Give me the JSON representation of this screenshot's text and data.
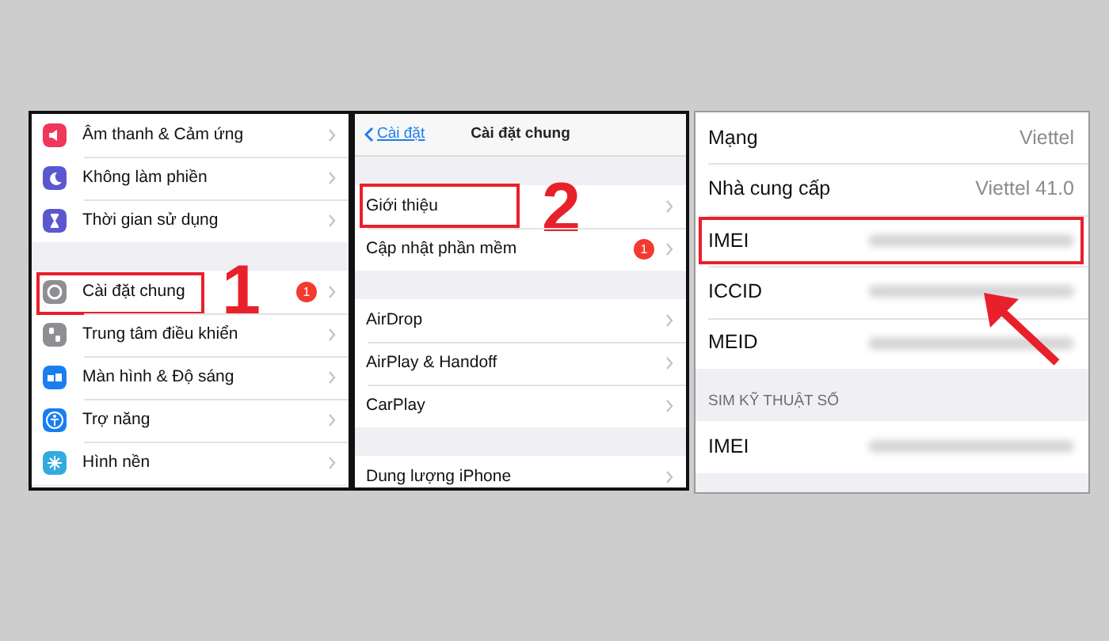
{
  "panels": [
    {
      "kind": "settings",
      "groups": [
        {
          "rows": [
            {
              "label": "Âm thanh & Cảm ứng",
              "color": "#f0365a",
              "highlighted": false
            },
            {
              "label": "Không làm phiền",
              "color": "#5b57d0",
              "highlighted": false
            },
            {
              "label": "Thời gian sử dụng",
              "color": "#5b57d0",
              "highlighted": false
            }
          ]
        },
        {
          "rows": [
            {
              "label": "Cài đặt chung",
              "color": "#8e8e93",
              "highlighted": true,
              "step": "1",
              "badge": "1"
            },
            {
              "label": "Trung tâm điều khiển",
              "color": "#8e8e93",
              "highlighted": false
            },
            {
              "label": "Màn hình & Độ sáng",
              "color": "#1a7ef0",
              "highlighted": false
            },
            {
              "label": "Trợ năng",
              "color": "#1a7ef0",
              "highlighted": false
            },
            {
              "label": "Hình nền",
              "color": "#35aadc",
              "highlighted": false
            }
          ]
        }
      ]
    },
    {
      "kind": "general",
      "nav": {
        "back": "Cài đặt",
        "title": "Cài đặt chung"
      },
      "groups": [
        {
          "rows": [
            {
              "label": "Giới thiệu",
              "highlighted": true,
              "step": "2"
            },
            {
              "label": "Cập nhật phần mềm",
              "highlighted": false,
              "badge": "1"
            }
          ]
        },
        {
          "rows": [
            {
              "label": "AirDrop",
              "highlighted": false
            },
            {
              "label": "AirPlay & Handoff",
              "highlighted": false
            },
            {
              "label": "CarPlay",
              "highlighted": false
            }
          ]
        },
        {
          "rows": [
            {
              "label": "Dung lượng iPhone",
              "highlighted": false
            }
          ]
        }
      ]
    },
    {
      "kind": "info",
      "groups": [
        {
          "rows": [
            {
              "label": "Mạng",
              "kind": "value",
              "value": "Viettel",
              "highlighted": false
            },
            {
              "label": "Nhà cung cấp",
              "kind": "value",
              "value": "Viettel 41.0",
              "highlighted": false
            },
            {
              "label": "IMEI",
              "kind": "blurred",
              "highlighted": true
            },
            {
              "label": "ICCID",
              "kind": "blurred",
              "highlighted": false
            },
            {
              "label": "MEID",
              "kind": "blurred",
              "highlighted": false
            }
          ]
        },
        {
          "header": "SIM KỸ THUẬT SỐ",
          "rows": [
            {
              "label": "IMEI",
              "kind": "blurred",
              "highlighted": false
            }
          ]
        }
      ]
    }
  ]
}
